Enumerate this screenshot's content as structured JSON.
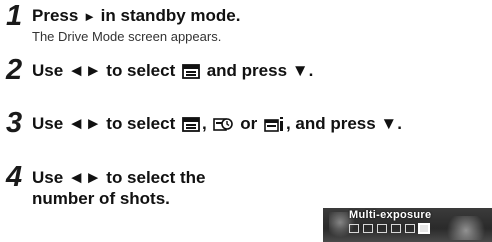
{
  "steps": [
    {
      "number": "1",
      "line1_pre": "Press",
      "line1_glyph": "►",
      "line1_post": " in standby mode.",
      "note": "The Drive Mode screen appears."
    },
    {
      "number": "2",
      "pre": "Use ◄► to select",
      "post": " and press ▼."
    },
    {
      "number": "3",
      "pre": "Use ◄► to select",
      "sep1": ",",
      "sep2": " or",
      "post": ", and press ▼."
    },
    {
      "number": "4",
      "line1": "Use ◄► to select the",
      "line2": "number of shots."
    }
  ],
  "screen": {
    "title": "Multi-exposure"
  }
}
